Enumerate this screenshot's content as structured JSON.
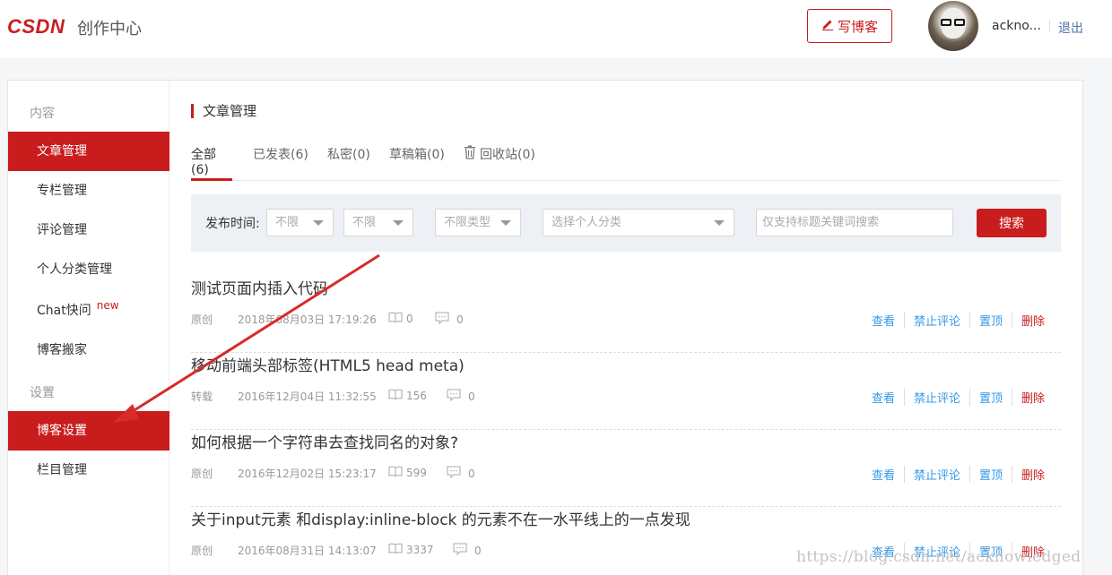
{
  "header": {
    "logo": "CSDN",
    "subtitle": "创作中心",
    "write_label": "写博客",
    "username": "ackno...",
    "logout": "退出"
  },
  "sidebar": {
    "group_content": "内容",
    "group_settings": "设置",
    "items": [
      {
        "label": "文章管理",
        "active": true
      },
      {
        "label": "专栏管理"
      },
      {
        "label": "评论管理"
      },
      {
        "label": "个人分类管理"
      },
      {
        "label": "Chat快问",
        "badge": "new"
      },
      {
        "label": "博客搬家"
      },
      {
        "label": "博客设置",
        "active": true
      },
      {
        "label": "栏目管理"
      }
    ]
  },
  "main": {
    "title": "文章管理",
    "tabs": [
      "全部(6)",
      "已发表(6)",
      "私密(0)",
      "草稿箱(0)",
      "回收站(0)"
    ],
    "filter": {
      "label": "发布时间:",
      "year": "不限",
      "month": "不限",
      "type": "不限类型",
      "category": "选择个人分类",
      "search_placeholder": "仅支持标题关键词搜索",
      "search_button": "搜索"
    },
    "articles": [
      {
        "title": "测试页面内插入代码",
        "type": "原创",
        "date": "2018年08月03日 17:19:26",
        "views": "0",
        "comments": "0"
      },
      {
        "title": "移动前端头部标签(HTML5 head meta)",
        "type": "转载",
        "date": "2016年12月04日 11:32:55",
        "views": "156",
        "comments": "0"
      },
      {
        "title": "如何根据一个字符串去查找同名的对象?",
        "type": "原创",
        "date": "2016年12月02日 15:23:17",
        "views": "599",
        "comments": "0"
      },
      {
        "title": "关于input元素 和display:inline-block 的元素不在一水平线上的一点发现",
        "type": "原创",
        "date": "2016年08月31日 14:13:07",
        "views": "3337",
        "comments": "0"
      }
    ],
    "actions": {
      "view": "查看",
      "ban": "禁止评论",
      "top": "置顶",
      "delete": "删除"
    }
  },
  "watermark": "https://blog.csdn.net/acknowledged",
  "colors": {
    "accent": "#c91d1d",
    "link": "#3399ea"
  }
}
